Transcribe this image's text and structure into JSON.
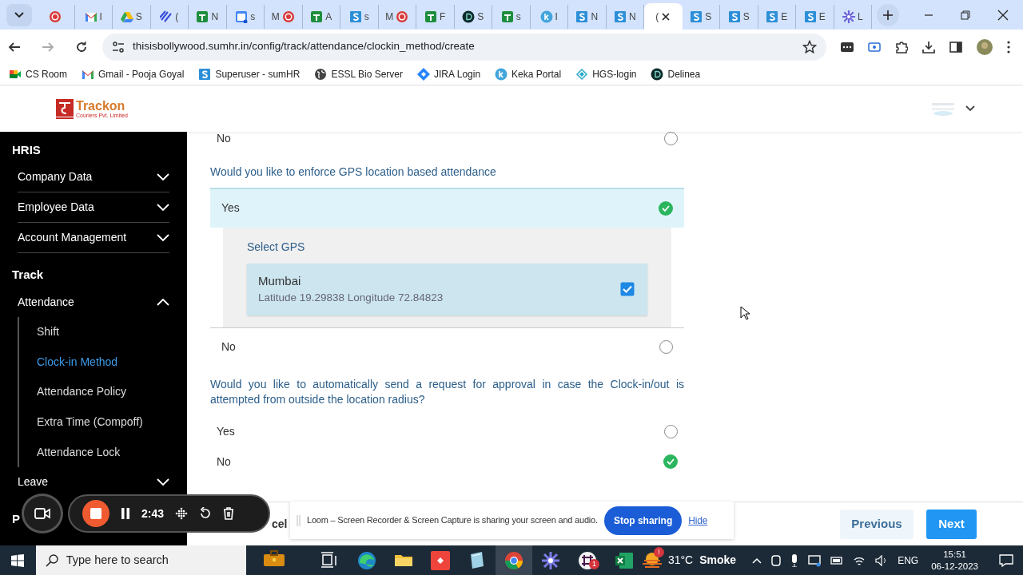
{
  "browser": {
    "tabs": [
      {
        "kind": "record",
        "selected": false
      },
      {
        "kind": "gmail",
        "label": "I",
        "selected": false
      },
      {
        "kind": "drive",
        "label": "S",
        "selected": false
      },
      {
        "kind": "stripes",
        "label": "(",
        "selected": false
      },
      {
        "kind": "sheets",
        "label": "N",
        "selected": false
      },
      {
        "kind": "calendar",
        "label": "s",
        "selected": false
      },
      {
        "kind": "record",
        "pre": "M",
        "selected": false
      },
      {
        "kind": "sheets",
        "label": "A",
        "selected": false
      },
      {
        "kind": "s",
        "label": "s",
        "selected": false
      },
      {
        "kind": "record",
        "pre": "M",
        "selected": false
      },
      {
        "kind": "sheets",
        "label": "F",
        "selected": false
      },
      {
        "kind": "d",
        "label": "S",
        "selected": false
      },
      {
        "kind": "sheets",
        "label": "s",
        "selected": false
      },
      {
        "kind": "k",
        "label": "I",
        "selected": false
      },
      {
        "kind": "s",
        "label": "N",
        "selected": false
      },
      {
        "kind": "s",
        "label": "N",
        "selected": false
      },
      {
        "kind": "none",
        "label": "(",
        "selected": true
      },
      {
        "kind": "s",
        "label": "S",
        "selected": false
      },
      {
        "kind": "s",
        "label": "S",
        "selected": false
      },
      {
        "kind": "s",
        "label": "E",
        "selected": false
      },
      {
        "kind": "s",
        "label": "E",
        "selected": false
      },
      {
        "kind": "flower",
        "label": "L",
        "selected": false
      }
    ],
    "url": "thisisbollywood.sumhr.in/config/track/attendance/clockin_method/create",
    "bookmarks": [
      {
        "kind": "meet",
        "label": "CS Room"
      },
      {
        "kind": "gmail",
        "label": "Gmail - Pooja Goyal"
      },
      {
        "kind": "s",
        "label": "Superuser - sumHR"
      },
      {
        "kind": "globe",
        "label": "ESSL Bio Server"
      },
      {
        "kind": "jira",
        "label": "JIRA Login"
      },
      {
        "kind": "k",
        "label": "Keka Portal"
      },
      {
        "kind": "hgs",
        "label": "HGS-login"
      },
      {
        "kind": "d",
        "label": "Delinea"
      }
    ]
  },
  "header": {
    "logo_text": "Trackon",
    "logo_subtext": "Couriers Pvt. Limited"
  },
  "sidebar": {
    "sections": [
      {
        "title": "HRIS",
        "items": [
          {
            "label": "Company Data",
            "expanded": false
          },
          {
            "label": "Employee Data",
            "expanded": false
          },
          {
            "label": "Account Management",
            "expanded": false
          }
        ]
      },
      {
        "title": "Track",
        "items": [
          {
            "label": "Attendance",
            "expanded": true,
            "children": [
              {
                "label": "Shift",
                "selected": false
              },
              {
                "label": "Clock-in Method",
                "selected": true
              },
              {
                "label": "Attendance Policy",
                "selected": false
              },
              {
                "label": "Extra Time (Compoff)",
                "selected": false
              },
              {
                "label": "Attendance Lock",
                "selected": false
              }
            ]
          },
          {
            "label": "Leave",
            "expanded": false
          }
        ]
      },
      {
        "title": "P"
      }
    ]
  },
  "form": {
    "top_options": [
      {
        "label": "No",
        "selected": false
      }
    ],
    "questions": [
      {
        "text": "Would you like to enforce GPS location based attendance",
        "options": [
          {
            "label": "Yes",
            "selected": true,
            "gps": {
              "title": "Select GPS",
              "locations": [
                {
                  "name": "Mumbai",
                  "coords": "Latitude 19.29838 Longitude 72.84823",
                  "checked": true
                }
              ]
            }
          },
          {
            "label": "No",
            "selected": false
          }
        ]
      },
      {
        "text": "Would you like to automatically send a request for approval in case the Clock-in/out is attempted from outside the location radius?",
        "options": [
          {
            "label": "Yes",
            "selected": false
          },
          {
            "label": "No",
            "selected": true
          }
        ]
      }
    ]
  },
  "footer": {
    "cancel": "cel",
    "previous": "Previous",
    "next": "Next"
  },
  "recorder": {
    "time": "2:43"
  },
  "loom": {
    "message": "Loom – Screen Recorder & Screen Capture is sharing your screen and audio.",
    "stop": "Stop sharing",
    "hide": "Hide"
  },
  "taskbar": {
    "search_placeholder": "Type here to search",
    "apps": [
      {
        "kind": "briefcase",
        "selected": false
      },
      {
        "kind": "taskview",
        "selected": false
      },
      {
        "kind": "edge",
        "selected": false
      },
      {
        "kind": "folder",
        "selected": false
      },
      {
        "kind": "anydesk",
        "selected": false
      },
      {
        "kind": "notepad",
        "selected": false
      },
      {
        "kind": "chrome",
        "selected": true
      },
      {
        "kind": "flower",
        "selected": false
      },
      {
        "kind": "slack",
        "badge": "1",
        "selected": false
      },
      {
        "kind": "excel",
        "selected": false
      }
    ],
    "weather": {
      "badge": "!",
      "temp": "31°C",
      "condition": "Smoke"
    },
    "language": "ENG",
    "time": "15:51",
    "date": "06-12-2023"
  }
}
